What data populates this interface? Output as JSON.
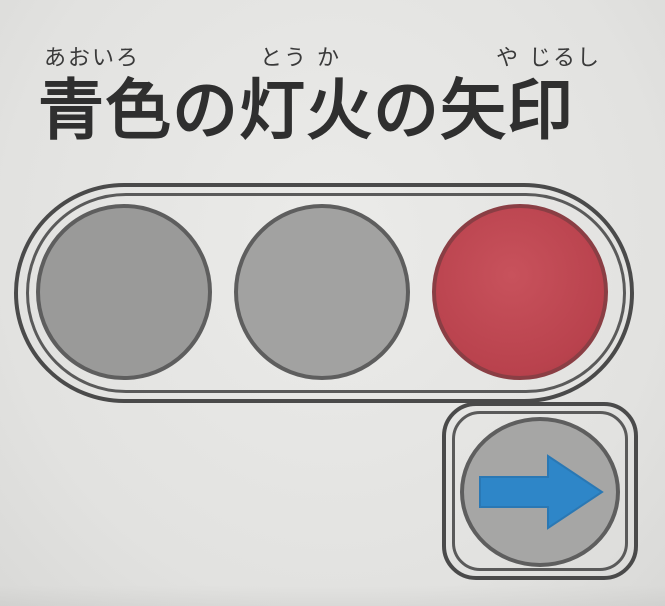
{
  "title": {
    "text": "青色の灯火の矢印",
    "furigana": {
      "aoiro": "あおいろ",
      "touka": "とう か",
      "yajirushi": "や じるし"
    }
  },
  "signal": {
    "lamps": [
      {
        "state": "off",
        "color": "#9a9a99"
      },
      {
        "state": "off",
        "color": "#a2a2a1"
      },
      {
        "state": "on",
        "color": "#b9424d"
      }
    ],
    "arrow": {
      "direction": "right",
      "color": "#2e86c8",
      "lamp_color": "#a6a6a5"
    }
  }
}
